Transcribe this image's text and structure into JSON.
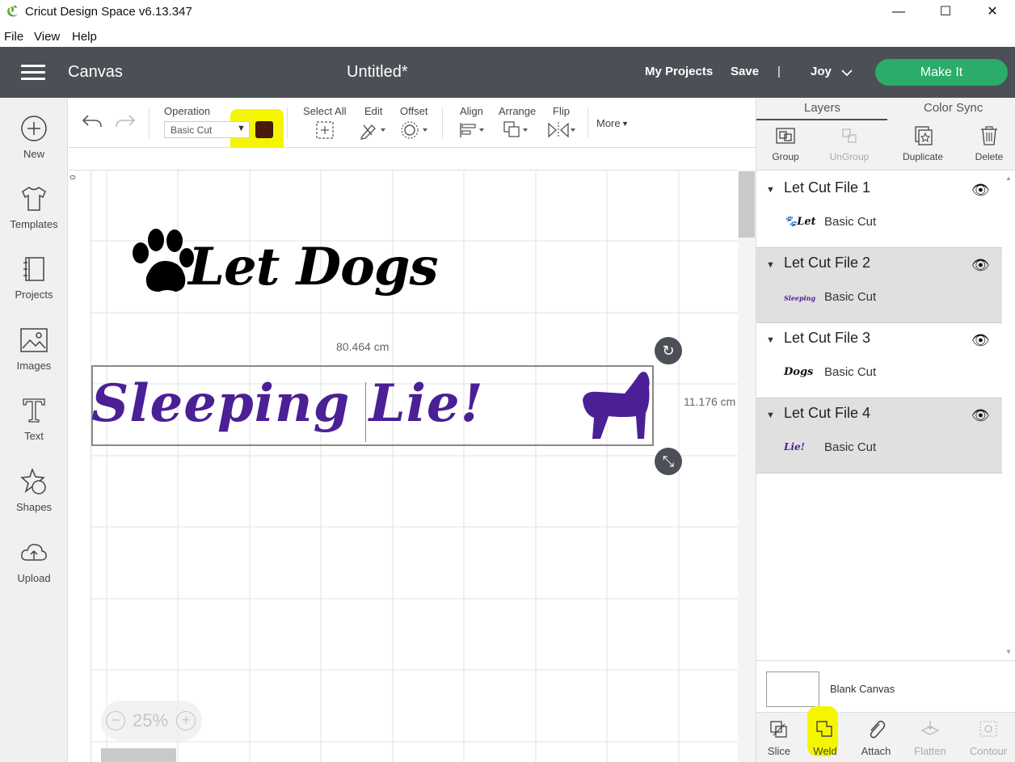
{
  "window": {
    "title": "Cricut Design Space  v6.13.347",
    "minimize": "—",
    "maximize": "☐",
    "close": "✕"
  },
  "menu": [
    "File",
    "View",
    "Help"
  ],
  "header": {
    "section": "Canvas",
    "document_title": "Untitled*",
    "my_projects": "My Projects",
    "save": "Save",
    "separator": "|",
    "user": "Joy",
    "make_it": "Make It",
    "accent": "#2bac6a",
    "bar_color": "#4c4f56"
  },
  "left_nav": [
    {
      "label": "New",
      "icon": "plus-circle-icon"
    },
    {
      "label": "Templates",
      "icon": "tshirt-icon"
    },
    {
      "label": "Projects",
      "icon": "book-icon"
    },
    {
      "label": "Images",
      "icon": "image-icon"
    },
    {
      "label": "Text",
      "icon": "text-icon"
    },
    {
      "label": "Shapes",
      "icon": "shapes-icon"
    },
    {
      "label": "Upload",
      "icon": "upload-cloud-icon"
    }
  ],
  "toolbar": {
    "operation_label": "Operation",
    "operation_value": "Basic Cut",
    "color_swatch": "#4a1a0c",
    "select_all": "Select All",
    "edit": "Edit",
    "offset": "Offset",
    "align": "Align",
    "arrange": "Arrange",
    "flip": "Flip",
    "more": "More"
  },
  "canvas": {
    "ruler_zero": "0",
    "line1": "Let Dogs",
    "line2": "Sleeping Lie!",
    "width_dim": "80.464 cm",
    "height_dim": "11.176 cm",
    "zoom": "25%",
    "zoom_minus": "−",
    "zoom_plus": "+",
    "purple": "#4b1f96"
  },
  "right_panel": {
    "tabs": [
      "Layers",
      "Color Sync"
    ],
    "tools": [
      {
        "label": "Group",
        "icon": "group-icon",
        "enabled": true
      },
      {
        "label": "UnGroup",
        "icon": "ungroup-icon",
        "enabled": false
      },
      {
        "label": "Duplicate",
        "icon": "duplicate-icon",
        "enabled": true
      },
      {
        "label": "Delete",
        "icon": "trash-icon",
        "enabled": true
      }
    ],
    "layers": [
      {
        "name": "Let Cut File 1",
        "operation": "Basic Cut",
        "thumb": "🐾Let",
        "thumb_color": "#111111"
      },
      {
        "name": "Let Cut File 2",
        "operation": "Basic Cut",
        "thumb": "Sleeping",
        "thumb_color": "#4b1f96"
      },
      {
        "name": "Let Cut File 3",
        "operation": "Basic Cut",
        "thumb": "Dogs",
        "thumb_color": "#111111"
      },
      {
        "name": "Let Cut File 4",
        "operation": "Basic Cut",
        "thumb": "Lie!",
        "thumb_color": "#4b1f96"
      }
    ],
    "blank_canvas": "Blank Canvas",
    "bottom_tools": [
      {
        "label": "Slice",
        "icon": "slice-icon",
        "enabled": true
      },
      {
        "label": "Weld",
        "icon": "weld-icon",
        "enabled": true
      },
      {
        "label": "Attach",
        "icon": "paperclip-icon",
        "enabled": true
      },
      {
        "label": "Flatten",
        "icon": "flatten-icon",
        "enabled": false
      },
      {
        "label": "Contour",
        "icon": "contour-icon",
        "enabled": false
      }
    ]
  },
  "highlight_color": "#f5f500"
}
